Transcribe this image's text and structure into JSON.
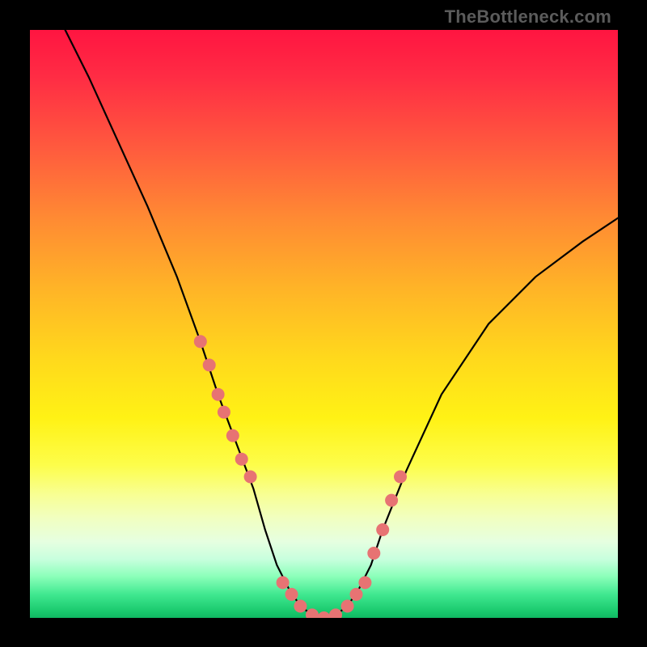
{
  "watermark": "TheBottleneck.com",
  "chart_data": {
    "type": "line",
    "title": "",
    "xlabel": "",
    "ylabel": "",
    "xlim": [
      0,
      100
    ],
    "ylim": [
      0,
      100
    ],
    "series": [
      {
        "name": "bottleneck-curve",
        "x": [
          6,
          10,
          15,
          20,
          25,
          29,
          32,
          35,
          38,
          40,
          42,
          44,
          46,
          48,
          50,
          52,
          54,
          56,
          58,
          60,
          64,
          70,
          78,
          86,
          94,
          100
        ],
        "y": [
          100,
          92,
          81,
          70,
          58,
          47,
          38,
          30,
          22,
          15,
          9,
          5,
          2,
          0.5,
          0,
          0.5,
          2,
          5,
          9,
          15,
          25,
          38,
          50,
          58,
          64,
          68
        ]
      }
    ],
    "scatter_points": {
      "name": "highlighted-points",
      "x": [
        29,
        30.5,
        32,
        33,
        34.5,
        36,
        37.5,
        43,
        44.5,
        46,
        48,
        50,
        52,
        54,
        55.5,
        57,
        58.5,
        60,
        61.5,
        63
      ],
      "y": [
        47,
        43,
        38,
        35,
        31,
        27,
        24,
        6,
        4,
        2,
        0.5,
        0,
        0.5,
        2,
        4,
        6,
        11,
        15,
        20,
        24
      ]
    },
    "background_gradient": {
      "top_color": "#ff1541",
      "mid_color": "#fff215",
      "bottom_color": "#11b862"
    }
  }
}
